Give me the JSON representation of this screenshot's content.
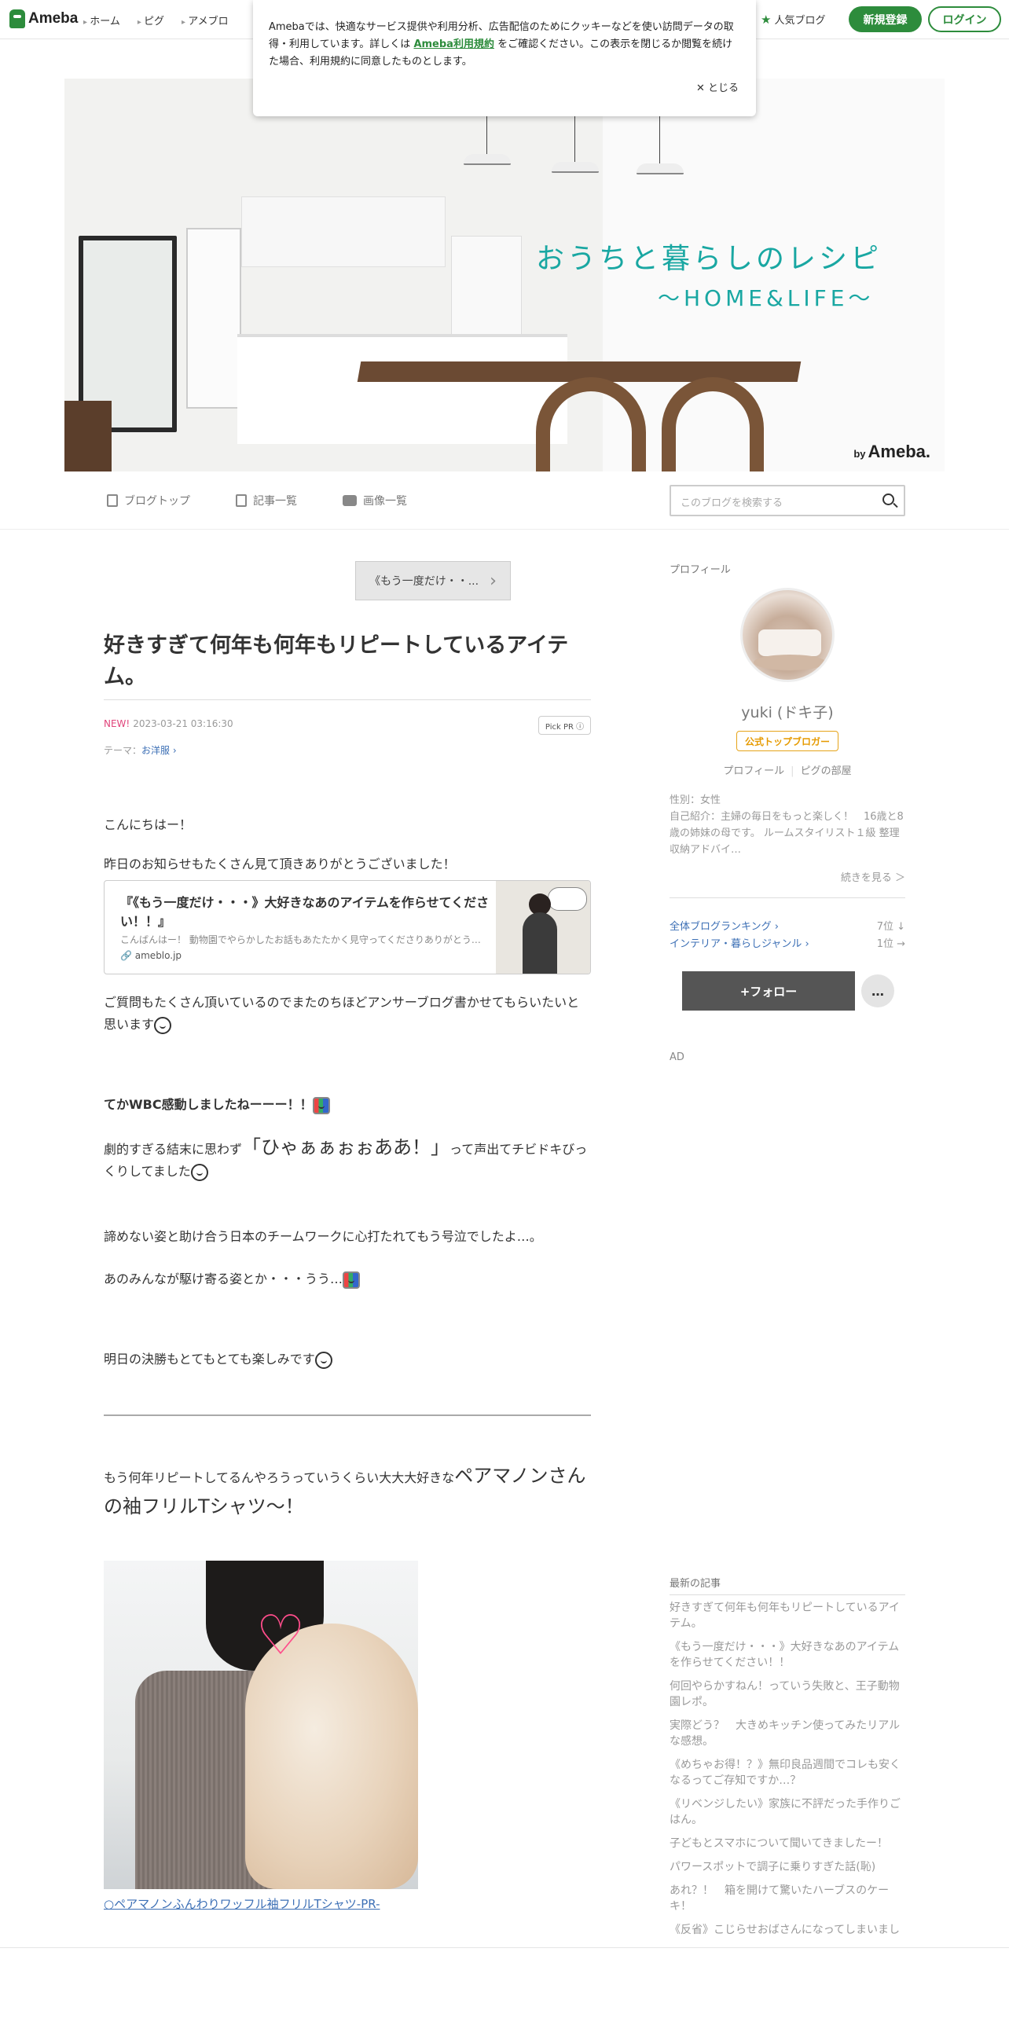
{
  "topbar": {
    "logo": "Ameba",
    "nav": [
      "ホーム",
      "ピグ",
      "アメブロ"
    ],
    "popular": "人気ブログ",
    "signup": "新規登録",
    "login": "ログイン"
  },
  "cookie": {
    "text_before": "Amebaでは、快適なサービス提供や利用分析、広告配信のためにクッキーなどを使い訪問データの取得・利用しています。詳しくは",
    "link": "Ameba利用規約",
    "text_after": "をご確認ください。この表示を閉じるか閲覧を続けた場合、利用規約に同意したものとします。",
    "close": "とじる"
  },
  "hero": {
    "title": "おうちと暮らしのレシピ",
    "subtitle": "〜HOME&LIFE〜",
    "by": "by",
    "brand": "Ameba."
  },
  "blognav": {
    "top": "ブログトップ",
    "list": "記事一覧",
    "images": "画像一覧",
    "search_placeholder": "このブログを検索する"
  },
  "entry": {
    "prev": "《もう一度だけ・・...",
    "title": "好きすぎて何年も何年もリピートしているアイテム。",
    "new": "NEW!",
    "datetime": "2023-03-21 03:16:30",
    "pickpr": "Pick PR ⓘ",
    "theme_label": "テーマ：",
    "theme": "お洋服",
    "p1": "こんにちはー！",
    "p2": "昨日のお知らせもたくさん見て頂きありがとうございました！",
    "card_title": "『《もう一度だけ・・・》大好きなあのアイテムを作らせてください！！』",
    "card_desc": "こんばんはー！ 動物園でやらかしたお話もあたたかく見守ってくださりありがとう…",
    "card_src": "ameblo.jp",
    "p3": "ご質問もたくさん頂いているのでまたのちほどアンサーブログ書かせてもらいたいと思います",
    "p4": "てかWBC感動しましたねーーー！！",
    "p5_a": "劇的すぎる結末に思わず",
    "p5_big": "「ひゃぁぁぉぉああ！」",
    "p5_b": "って声出てチビドキびっくりしてました",
    "p6": "諦めない姿と助け合う日本のチームワークに心打たれてもう号泣でしたよ…。",
    "p7": "あのみんなが駆け寄る姿とか・・・うう…",
    "p8": "明日の決勝もとてもとても楽しみです",
    "p9_a": "もう何年リピートしてるんやろうっていうくらい大大大好きな",
    "p9_big": "ペアマノンさんの袖フリルTシャツ～！",
    "photo_link": "○ペアマノンふんわりワッフル袖フリルTシャツ-PR-"
  },
  "side": {
    "profile_h": "プロフィール",
    "name": "yuki (ドキ子)",
    "badge": "公式トップブロガー",
    "link_profile": "プロフィール",
    "link_room": "ピグの部屋",
    "gender": "性別：女性",
    "intro": "自己紹介：主婦の毎日をもっと楽しく！　16歳と8歳の姉妹の母です。 ルームスタイリスト１級 整理収納アドバイ…",
    "more": "続きを見る ＞",
    "rank1_label": "全体ブログランキング",
    "rank1_val": "7位 ↓",
    "rank2_label": "インテリア・暮らしジャンル",
    "rank2_val": "1位 →",
    "follow": "+フォロー",
    "dots": "…",
    "ad": "AD",
    "latest_h": "最新の記事",
    "latest": [
      "好きすぎて何年も何年もリピートしているアイテム。",
      "《もう一度だけ・・・》大好きなあのアイテムを作らせてください！！",
      "何回やらかすねん！っていう失敗と、王子動物園レポ。",
      "実際どう？　大きめキッチン使ってみたリアルな感想。",
      "《めちゃお得！？》無印良品週間でコレも安くなるってご存知ですか…？",
      "《リベンジしたい》家族に不評だった手作りごはん。",
      "子どもとスマホについて聞いてきましたー！",
      "パワースポットで調子に乗りすぎた話(恥)",
      "あれ？！　箱を開けて驚いたハーブスのケーキ！",
      "《反省》こじらせおばさんになってしまいまし"
    ]
  }
}
